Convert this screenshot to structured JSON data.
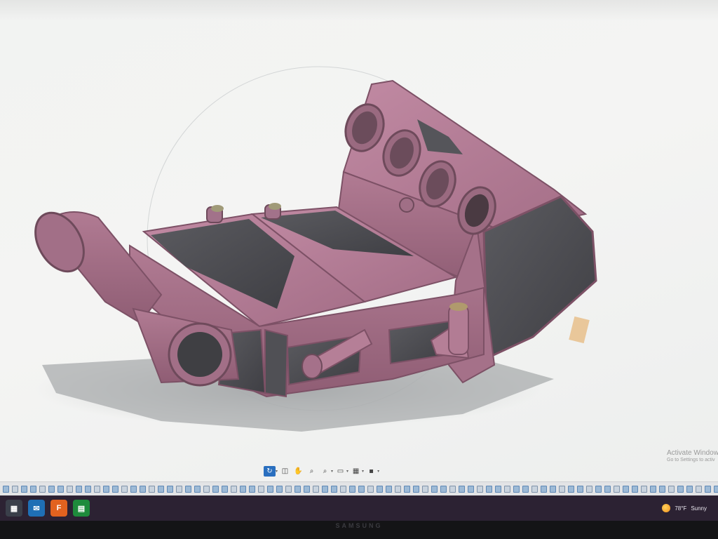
{
  "viewport": {
    "model_name": "intercooler-manifold",
    "body_color": "#b57f97",
    "face_color": "#4b4b4f"
  },
  "nav_toolbar": {
    "tools": [
      {
        "name": "orbit-icon",
        "glyph": "↻",
        "active": true
      },
      {
        "name": "look-at-icon",
        "glyph": "◫"
      },
      {
        "name": "pan-icon",
        "glyph": "✋"
      },
      {
        "name": "zoom-icon",
        "glyph": "⌕"
      },
      {
        "name": "zoom-window-icon",
        "glyph": "⌕"
      },
      {
        "name": "display-settings-icon",
        "glyph": "▭"
      },
      {
        "name": "grid-settings-icon",
        "glyph": "▦"
      },
      {
        "name": "viewports-icon",
        "glyph": "▪"
      }
    ]
  },
  "timeline": {
    "feature_count": 88
  },
  "watermark": {
    "title": "Activate Window",
    "subtitle": "Go to Settings to activ"
  },
  "taskbar": {
    "apps": [
      {
        "name": "task-view-icon",
        "glyph": "▦"
      },
      {
        "name": "mail-icon",
        "glyph": "✉"
      },
      {
        "name": "fusion-app-icon",
        "glyph": "F"
      },
      {
        "name": "sheets-app-icon",
        "glyph": "▤"
      }
    ],
    "weather": {
      "temp": "78°F",
      "condition": "Sunny"
    }
  },
  "bezel": {
    "brand": "SAMSUNG"
  }
}
